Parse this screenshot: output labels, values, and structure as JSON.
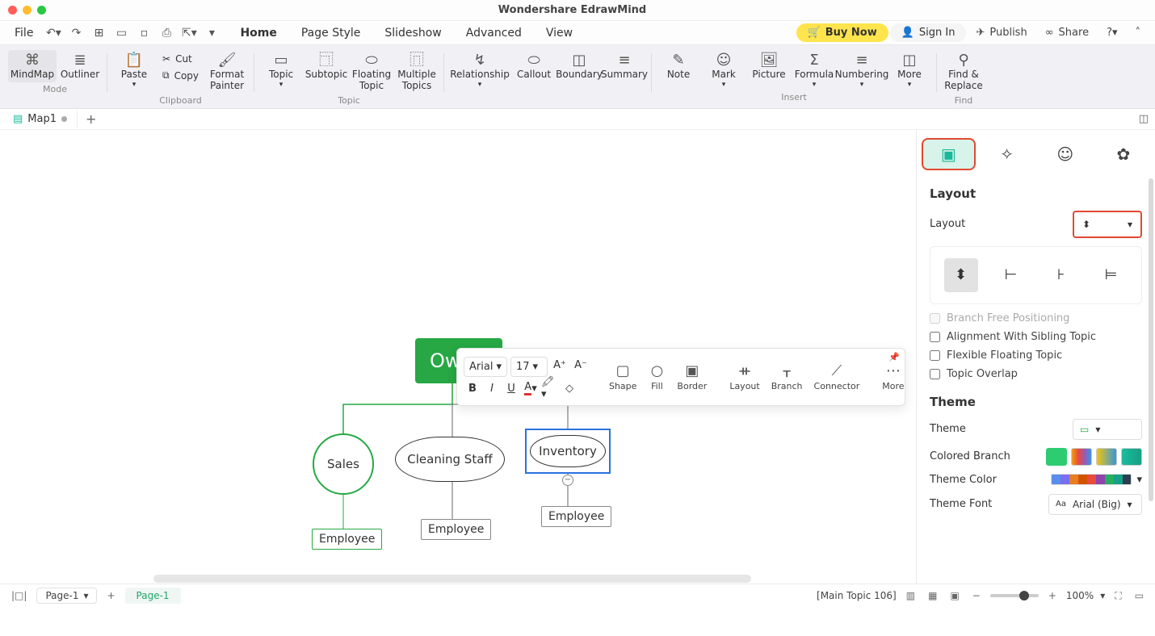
{
  "app_title": "Wondershare EdrawMind",
  "menubar": {
    "file": "File",
    "tabs": [
      "Home",
      "Page Style",
      "Slideshow",
      "Advanced",
      "View"
    ],
    "active_tab": "Home",
    "buy": "Buy Now",
    "signin": "Sign In",
    "publish": "Publish",
    "share": "Share"
  },
  "ribbon": {
    "mode": {
      "mindmap": "MindMap",
      "outliner": "Outliner",
      "label": "Mode"
    },
    "clipboard": {
      "paste": "Paste",
      "cut": "Cut",
      "copy": "Copy",
      "format_painter": "Format\nPainter",
      "label": "Clipboard"
    },
    "topic": {
      "topic": "Topic",
      "subtopic": "Subtopic",
      "floating": "Floating\nTopic",
      "multiple": "Multiple\nTopics",
      "label": "Topic"
    },
    "relation": {
      "relationship": "Relationship",
      "callout": "Callout",
      "boundary": "Boundary",
      "summary": "Summary"
    },
    "insert": {
      "note": "Note",
      "mark": "Mark",
      "picture": "Picture",
      "formula": "Formula",
      "numbering": "Numbering",
      "more": "More",
      "label": "Insert"
    },
    "find": {
      "find_replace": "Find &\nReplace",
      "label": "Find"
    }
  },
  "doctab": {
    "name": "Map1"
  },
  "canvas": {
    "owner": "Ow",
    "sales": "Sales",
    "cleaning": "Cleaning Staff",
    "inventory": "Inventory",
    "emp": "Employee"
  },
  "float": {
    "font": "Arial",
    "size": "17",
    "shape": "Shape",
    "fill": "Fill",
    "border": "Border",
    "layout": "Layout",
    "branch": "Branch",
    "connector": "Connector",
    "more": "More"
  },
  "rpanel": {
    "layout_h": "Layout",
    "layout_l": "Layout",
    "branch_free": "Branch Free Positioning",
    "align_sibling": "Alignment With Sibling Topic",
    "flex_float": "Flexible Floating Topic",
    "topic_overlap": "Topic Overlap",
    "theme_h": "Theme",
    "theme_l": "Theme",
    "colored_branch": "Colored Branch",
    "theme_color": "Theme Color",
    "theme_font": "Theme Font",
    "theme_font_val": "Arial (Big)"
  },
  "status": {
    "page_sel": "Page-1",
    "page_tab": "Page-1",
    "selection": "[Main Topic 106]",
    "zoom": "100%"
  }
}
